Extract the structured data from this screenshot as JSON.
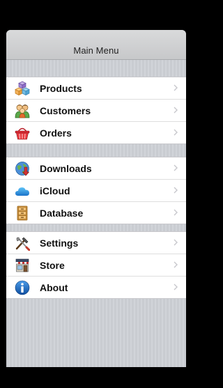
{
  "nav": {
    "title": "Main Menu"
  },
  "groups": [
    {
      "items": [
        {
          "label": "Products",
          "icon": "boxes-icon"
        },
        {
          "label": "Customers",
          "icon": "customers-icon"
        },
        {
          "label": "Orders",
          "icon": "basket-icon"
        }
      ]
    },
    {
      "items": [
        {
          "label": "Downloads",
          "icon": "downloads-icon"
        },
        {
          "label": "iCloud",
          "icon": "cloud-icon"
        },
        {
          "label": "Database",
          "icon": "cabinet-icon"
        }
      ]
    },
    {
      "items": [
        {
          "label": "Settings",
          "icon": "tools-icon"
        },
        {
          "label": "Store",
          "icon": "store-icon"
        },
        {
          "label": "About",
          "icon": "info-icon"
        }
      ]
    }
  ],
  "colors": {
    "accent": "#1a72c9",
    "chevron": "#c7c7cc"
  }
}
